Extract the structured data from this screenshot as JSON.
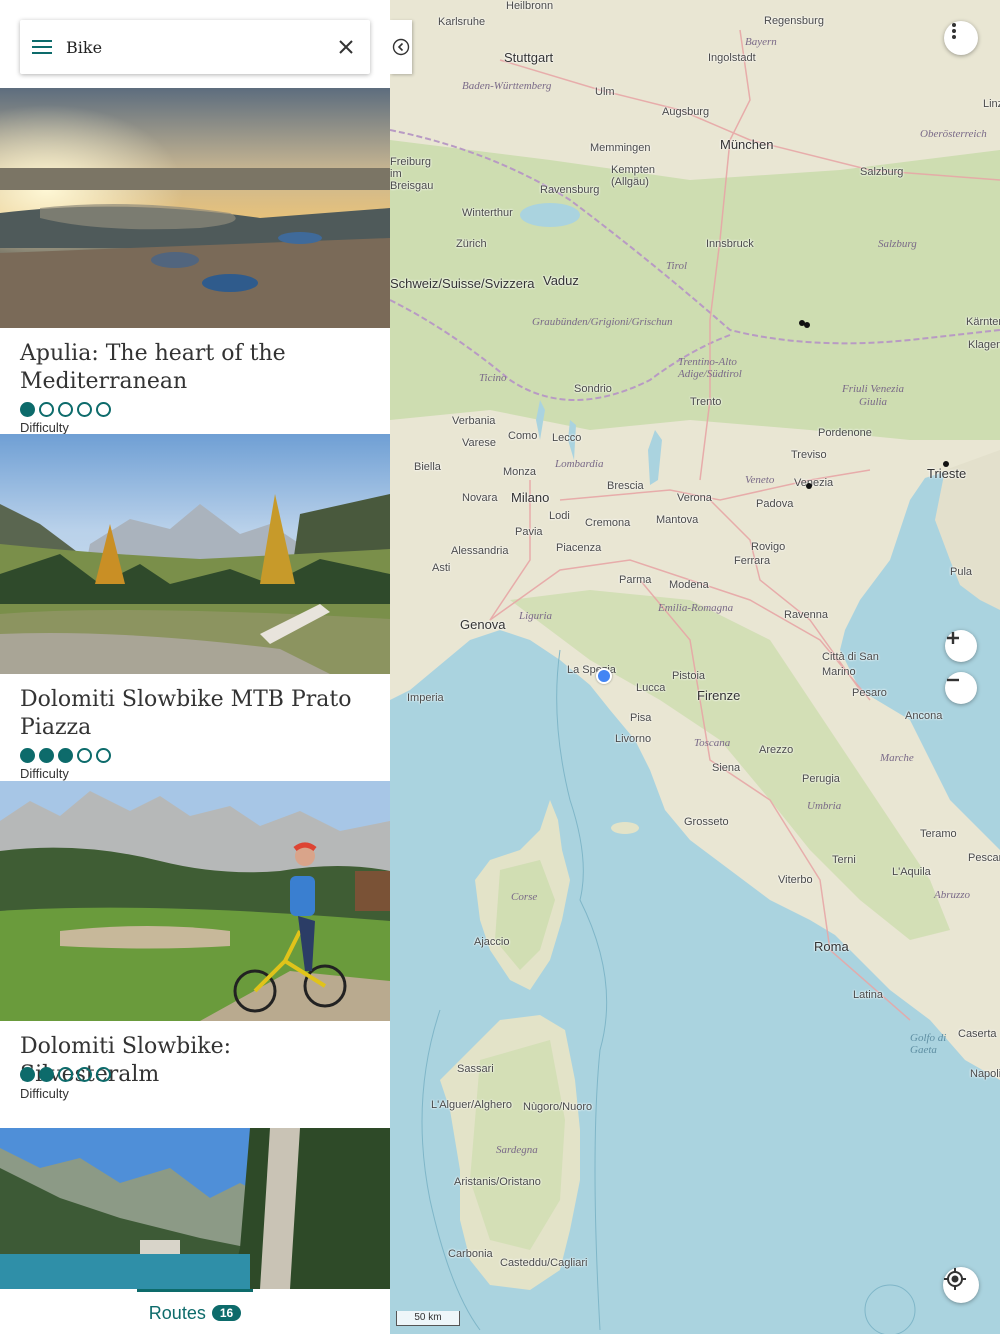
{
  "search": {
    "query": "Bike"
  },
  "cards": [
    {
      "title": "Apulia: The heart of the Mediterranean",
      "difficulty": 1,
      "difficulty_label": "Difficulty"
    },
    {
      "title": "Dolomiti Slowbike MTB Prato Piazza",
      "difficulty": 3,
      "difficulty_label": "Difficulty"
    },
    {
      "title": "Dolomiti Slowbike: Silvesteralm",
      "difficulty": 2,
      "difficulty_label": "Difficulty"
    },
    {
      "title": "",
      "difficulty": 0,
      "difficulty_label": ""
    }
  ],
  "tabs": {
    "routes_label": "Routes",
    "routes_count": "16"
  },
  "map": {
    "scale_label": "50 km",
    "colors": {
      "sea": "#aad3df",
      "land": "#e9e6d3",
      "forest": "#bfd6a0",
      "accent": "#0d6b6b",
      "location": "#4285f4"
    },
    "cities": [
      "Heilbronn",
      "Karlsruhe",
      "Regensburg",
      "Bayern",
      "Stuttgart",
      "Ingolstadt",
      "Baden-Württemberg",
      "Ulm",
      "Augsburg",
      "Linz",
      "München",
      "Memmingen",
      "Kempten (Allgäu)",
      "Oberösterreich",
      "Freiburg im Breisgau",
      "Ravensburg",
      "Salzburg",
      "Winterthur",
      "Zürich",
      "Innsbruck",
      "Salzburg",
      "Tirol",
      "Vaduz",
      "Schweiz/Suisse/Svizzera",
      "Graubünden/Grigioni/Grischun",
      "Kärnten",
      "Klagenfurt",
      "Trentino-Alto Adige/Südtirol",
      "Ticino",
      "Sondrio",
      "Friuli Venezia Giulia",
      "Trento",
      "Verbania",
      "Como",
      "Lecco",
      "Pordenone",
      "Varese",
      "Biella",
      "Lombardia",
      "Treviso",
      "Trieste",
      "Monza",
      "Veneto",
      "Venezia",
      "Novara",
      "Milano",
      "Brescia",
      "Verona",
      "Padova",
      "Lodi",
      "Cremona",
      "Mantova",
      "Pavia",
      "Alessandria",
      "Piacenza",
      "Rovigo",
      "Ferrara",
      "Asti",
      "Parma",
      "Modena",
      "Pula",
      "Emilia-Romagna",
      "Genova",
      "Liguria",
      "Ravenna",
      "La Spezia",
      "Città di San Marino",
      "Imperia",
      "Lucca",
      "Pistoia",
      "Pesaro",
      "Firenze",
      "Ancona",
      "Pisa",
      "Livorno",
      "Toscana",
      "Arezzo",
      "Siena",
      "Marche",
      "Perugia",
      "Umbria",
      "Grosseto",
      "Teramo",
      "Corse",
      "Pescara",
      "Terni",
      "L'Aquila",
      "Ajaccio",
      "Viterbo",
      "Abruzzo",
      "Roma",
      "Latina",
      "Caserta",
      "Napoli",
      "Sassari",
      "L'Alguer/Alghero",
      "Nùgoro/Nuoro",
      "Sardegna",
      "Aristanis/Oristano",
      "Carbonia",
      "Casteddu/Cagliari",
      "Golfo di Gaeta"
    ]
  }
}
